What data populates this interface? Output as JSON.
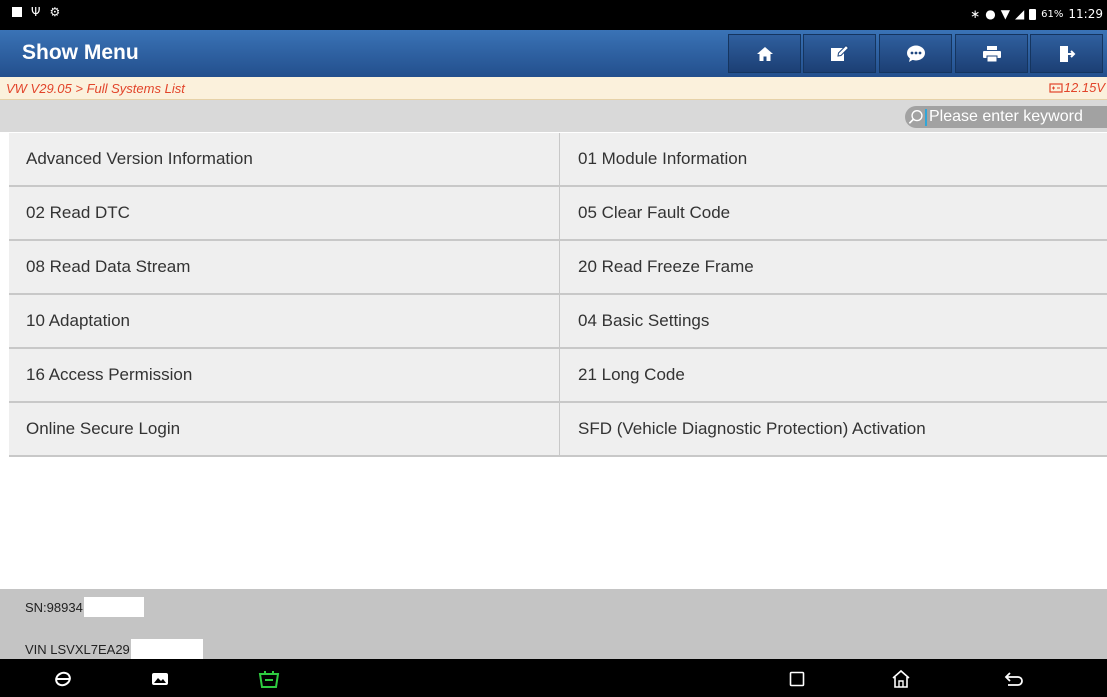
{
  "status_bar": {
    "battery": "61%",
    "time": "11:29"
  },
  "header": {
    "title": "Show Menu",
    "toolbar": [
      "home-icon",
      "edit-icon",
      "chat-icon",
      "print-icon",
      "exit-icon"
    ]
  },
  "breadcrumb": {
    "path": "VW V29.05 > Full Systems List",
    "voltage": "12.15V"
  },
  "search": {
    "placeholder": "Please enter keyword"
  },
  "menu": {
    "rows": [
      {
        "left": "Advanced Version Information",
        "right": "01 Module Information"
      },
      {
        "left": "02 Read DTC",
        "right": "05 Clear Fault Code"
      },
      {
        "left": "08 Read Data Stream",
        "right": "20 Read Freeze Frame"
      },
      {
        "left": "10 Adaptation",
        "right": "04 Basic Settings"
      },
      {
        "left": "16 Access Permission",
        "right": "21 Long Code"
      },
      {
        "left": "Online Secure Login",
        "right": "SFD (Vehicle Diagnostic Protection) Activation"
      }
    ]
  },
  "footer": {
    "sn": "SN:98934",
    "vin": "VIN LSVXL7EA29"
  },
  "colors": {
    "header_blue": "#2b5c9e",
    "breadcrumb_text": "#e2442a",
    "vci_green": "#2ecc40"
  }
}
